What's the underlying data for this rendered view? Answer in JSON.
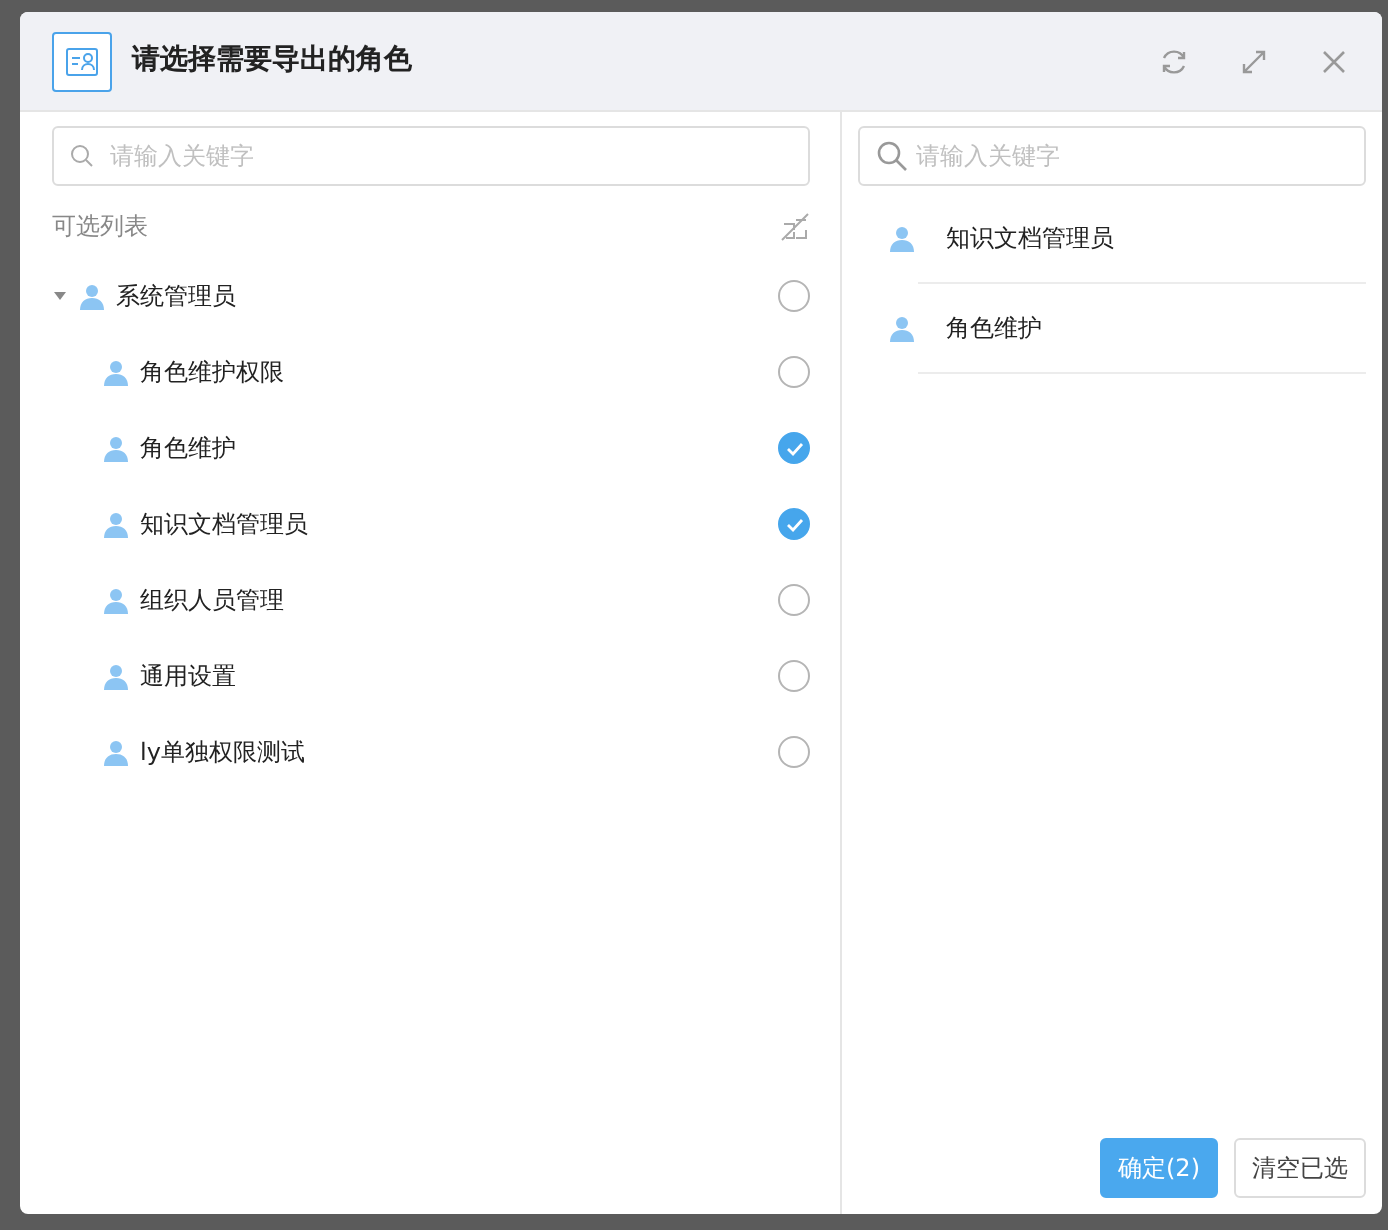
{
  "dialog": {
    "title": "请选择需要导出的角色"
  },
  "left_panel": {
    "search": {
      "placeholder": "请输入关键字"
    },
    "list_title": "可选列表",
    "tree": [
      {
        "label": "系统管理员",
        "expanded": true,
        "checked": false,
        "children": [
          {
            "label": "角色维护权限",
            "checked": false
          },
          {
            "label": "角色维护",
            "checked": true
          },
          {
            "label": "知识文档管理员",
            "checked": true
          },
          {
            "label": "组织人员管理",
            "checked": false
          },
          {
            "label": "通用设置",
            "checked": false
          },
          {
            "label": "ly单独权限测试",
            "checked": false
          }
        ]
      }
    ]
  },
  "right_panel": {
    "search": {
      "placeholder": "请输入关键字"
    },
    "selected_items": [
      {
        "label": "知识文档管理员"
      },
      {
        "label": "角色维护"
      }
    ]
  },
  "buttons": [
    {
      "label": "确定(2)",
      "kind": "primary"
    },
    {
      "label": "清空已选",
      "kind": "secondary"
    }
  ]
}
